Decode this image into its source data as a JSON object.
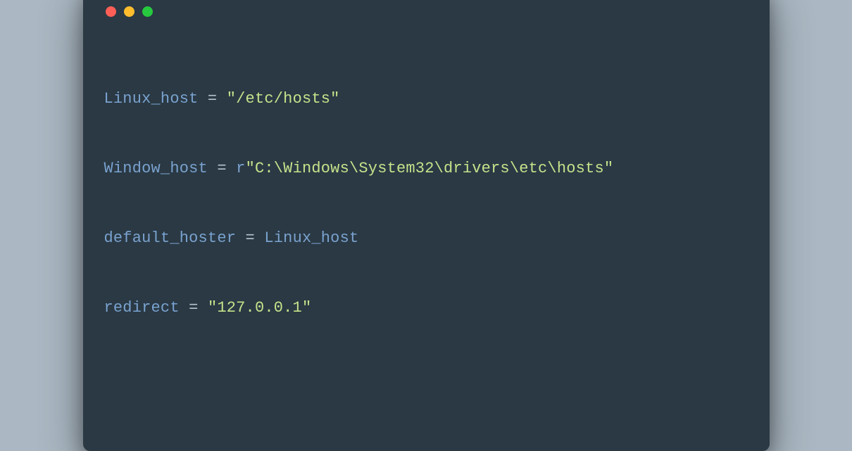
{
  "window": {
    "buttons": {
      "close": "close",
      "minimize": "minimize",
      "zoom": "zoom"
    }
  },
  "code": {
    "lines": [
      {
        "var": "Linux_host",
        "op1": " = ",
        "prefix": "",
        "str": "\"/etc/hosts\""
      },
      {
        "var": "Window_host",
        "op1": " = ",
        "prefix": "r",
        "str": "\"C:\\Windows\\System32\\drivers\\etc\\hosts\""
      },
      {
        "var": "default_hoster",
        "op1": " = ",
        "prefix": "",
        "rhs_var": "Linux_host"
      },
      {
        "var": "redirect",
        "op1": " = ",
        "prefix": "",
        "str": "\"127.0.0.1\""
      }
    ]
  }
}
